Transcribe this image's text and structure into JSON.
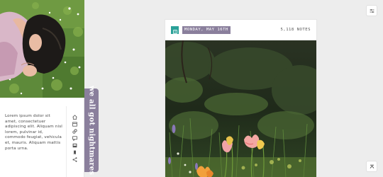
{
  "sidebar": {
    "bio": "Lorem ipsum dolor sit amet, consectetuer adipiscing elit. Aliquam nisl lorem, pulvinar id, commodo feugiat, vehicula et, mauris. Aliquam mattis porta urna.",
    "nav_icons": [
      "home-icon",
      "archive-icon",
      "link-icon",
      "chat-icon",
      "inbox-icon",
      "tag-icon",
      "share-icon"
    ]
  },
  "blog": {
    "title": "we all got nightmares"
  },
  "post": {
    "type_icon": "text-post-icon",
    "date": "MONDAY, MAY 16TH",
    "notes": "5,118 NOTES"
  },
  "controls": {
    "top_button_icon": "sliders-icon",
    "bottom_button_icon": "scroll-top-icon"
  },
  "colors": {
    "accent_purple": "#8a7f9c",
    "accent_teal": "#2aa198",
    "background": "#ededed"
  }
}
